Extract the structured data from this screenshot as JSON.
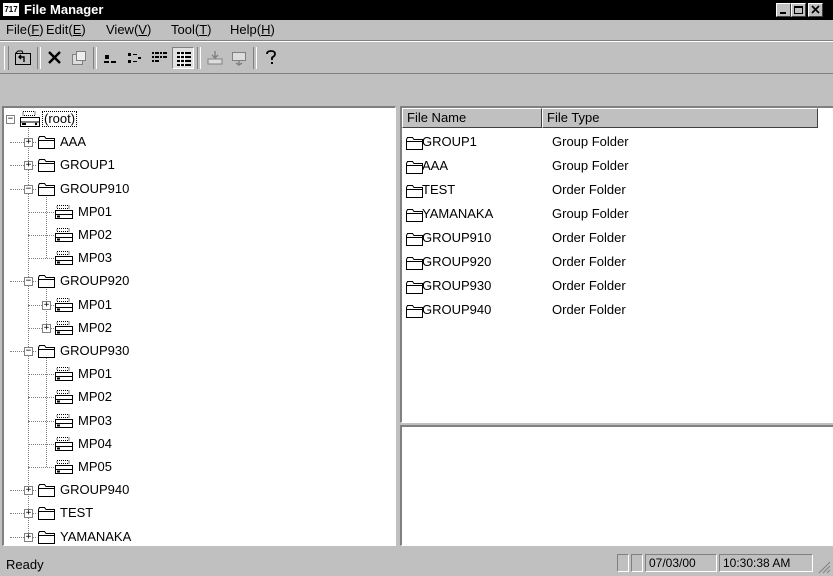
{
  "window": {
    "title": "File Manager",
    "icon_text": "717"
  },
  "window_buttons": [
    "minimize-icon",
    "maximize-icon",
    "close-icon"
  ],
  "menu": [
    {
      "label": "File(",
      "key": "F",
      "tail": ")"
    },
    {
      "label": "Edit(",
      "key": "E",
      "tail": ")"
    },
    {
      "label": "View(",
      "key": "V",
      "tail": ")"
    },
    {
      "label": "Tool(",
      "key": "T",
      "tail": ")"
    },
    {
      "label": "Help(",
      "key": "H",
      "tail": ")"
    }
  ],
  "toolbar_icons": [
    "up-folder-icon",
    "delete-icon",
    "properties-icon",
    "large-icons-icon",
    "small-icons-icon",
    "list-icon",
    "details-icon",
    "transfer-icon",
    "send-icon",
    "help-icon"
  ],
  "tree": {
    "root_label": "(root)",
    "nodes": [
      {
        "label": "AAA",
        "depth": 1,
        "type": "folder",
        "expander": "+"
      },
      {
        "label": "GROUP1",
        "depth": 1,
        "type": "folder",
        "expander": "+"
      },
      {
        "label": "GROUP910",
        "depth": 1,
        "type": "folder",
        "expander": "-"
      },
      {
        "label": "MP01",
        "depth": 2,
        "type": "drive",
        "expander": ""
      },
      {
        "label": "MP02",
        "depth": 2,
        "type": "drive",
        "expander": ""
      },
      {
        "label": "MP03",
        "depth": 2,
        "type": "drive",
        "expander": ""
      },
      {
        "label": "GROUP920",
        "depth": 1,
        "type": "folder",
        "expander": "-"
      },
      {
        "label": "MP01",
        "depth": 2,
        "type": "drive",
        "expander": "+"
      },
      {
        "label": "MP02",
        "depth": 2,
        "type": "drive",
        "expander": "+"
      },
      {
        "label": "GROUP930",
        "depth": 1,
        "type": "folder",
        "expander": "-"
      },
      {
        "label": "MP01",
        "depth": 2,
        "type": "drive",
        "expander": ""
      },
      {
        "label": "MP02",
        "depth": 2,
        "type": "drive",
        "expander": ""
      },
      {
        "label": "MP03",
        "depth": 2,
        "type": "drive",
        "expander": ""
      },
      {
        "label": "MP04",
        "depth": 2,
        "type": "drive",
        "expander": ""
      },
      {
        "label": "MP05",
        "depth": 2,
        "type": "drive",
        "expander": ""
      },
      {
        "label": "GROUP940",
        "depth": 1,
        "type": "folder",
        "expander": "+"
      },
      {
        "label": "TEST",
        "depth": 1,
        "type": "folder",
        "expander": "+"
      },
      {
        "label": "YAMANAKA",
        "depth": 1,
        "type": "folder",
        "expander": "+"
      }
    ]
  },
  "list": {
    "columns": [
      "File Name",
      "File Type"
    ],
    "rows": [
      {
        "name": "GROUP1",
        "type": "Group Folder"
      },
      {
        "name": "AAA",
        "type": "Group Folder"
      },
      {
        "name": "TEST",
        "type": "Order Folder"
      },
      {
        "name": "YAMANAKA",
        "type": "Group Folder"
      },
      {
        "name": "GROUP910",
        "type": "Order Folder"
      },
      {
        "name": "GROUP920",
        "type": "Order Folder"
      },
      {
        "name": "GROUP930",
        "type": "Order Folder"
      },
      {
        "name": "GROUP940",
        "type": "Order Folder"
      }
    ]
  },
  "status": {
    "text": "Ready",
    "date": "07/03/00",
    "time": "10:30:38 AM"
  }
}
